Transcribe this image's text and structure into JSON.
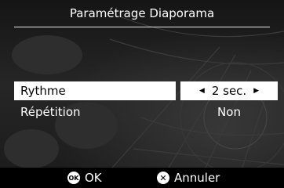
{
  "header": {
    "title": "Paramétrage Diaporama"
  },
  "settings": {
    "rythme": {
      "label": "Rythme",
      "value": "2 sec.",
      "left_arrow": "◀",
      "right_arrow": "▶"
    },
    "repetition": {
      "label": "Répétition",
      "value": "Non"
    }
  },
  "footer": {
    "ok": {
      "icon": "ok-button-icon",
      "icon_text": "OK",
      "label": "OK"
    },
    "cancel": {
      "icon": "cross-circle-icon",
      "icon_text": "✕",
      "label": "Annuler"
    }
  }
}
